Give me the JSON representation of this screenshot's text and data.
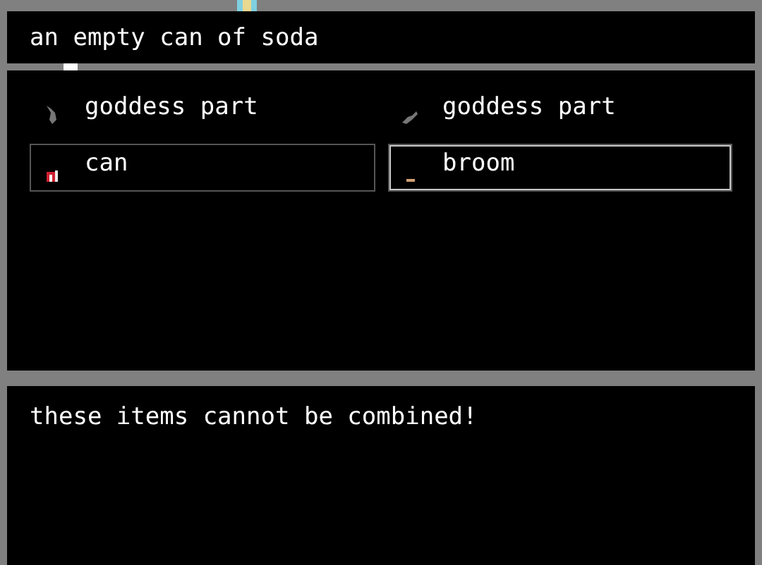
{
  "description": {
    "text": "an empty can of soda"
  },
  "items": [
    {
      "name": "goddess part",
      "chosen": false,
      "selected": false
    },
    {
      "name": "goddess part",
      "chosen": false,
      "selected": false
    },
    {
      "name": "can",
      "chosen": true,
      "selected": false
    },
    {
      "name": "broom",
      "chosen": true,
      "selected": true
    }
  ],
  "message": {
    "text": "these items cannot be combined!"
  }
}
